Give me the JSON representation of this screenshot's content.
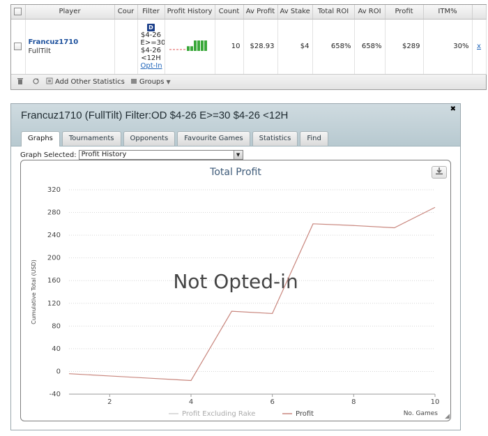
{
  "table": {
    "headers": [
      "Player",
      "Cour",
      "Filter",
      "Profit History",
      "Count",
      "Av Profit",
      "Av Stake",
      "Total ROI",
      "Av ROI",
      "Profit",
      "ITM%"
    ],
    "row": {
      "player_name": "Francuz1710",
      "site": "FullTilt",
      "filter_badge": "D",
      "filter_lines": [
        "$4-26",
        "E>=30",
        "$4-26",
        "<12H"
      ],
      "opt_in": "Opt-In",
      "count": "10",
      "av_profit": "$28.93",
      "av_stake": "$4",
      "total_roi": "658%",
      "av_roi": "658%",
      "profit": "$289",
      "itm": "30%",
      "remove": "x"
    },
    "profit_history_bars": [
      0,
      0,
      0,
      0,
      0,
      0.45,
      0.45,
      1.0,
      1.0,
      1.0,
      1.0
    ]
  },
  "toolbar": {
    "add_stats": "Add Other Statistics",
    "groups": "Groups"
  },
  "panel": {
    "title": "Francuz1710 (FullTilt) Filter:OD $4-26 E>=30 $4-26 <12H",
    "tabs": [
      "Graphs",
      "Tournaments",
      "Opponents",
      "Favourite Games",
      "Statistics",
      "Find"
    ],
    "active_tab": 0,
    "graph_selected_label": "Graph Selected:",
    "graph_selected_value": "Profit History"
  },
  "chart_data": {
    "type": "line",
    "title": "Total Profit",
    "ylabel": "Cumulative Total (USD)",
    "xlabel": "No. Games",
    "xlim": [
      1,
      10
    ],
    "ylim": [
      -40,
      320
    ],
    "yticks": [
      -40,
      0,
      40,
      80,
      120,
      160,
      200,
      240,
      280,
      320
    ],
    "xticks": [
      2,
      4,
      6,
      8,
      10
    ],
    "grid": true,
    "watermark": "Not Opted-in",
    "x": [
      1,
      2,
      3,
      4,
      5,
      6,
      7,
      8,
      9,
      10
    ],
    "series": [
      {
        "name": "Profit Excluding Rake",
        "values": [],
        "color": "#d0d0d0"
      },
      {
        "name": "Profit",
        "values": [
          -4,
          -8,
          -12,
          -16,
          106,
          102,
          260,
          257,
          253,
          289
        ],
        "color": "#c8857c"
      }
    ],
    "legend_position": "bottom-center"
  }
}
